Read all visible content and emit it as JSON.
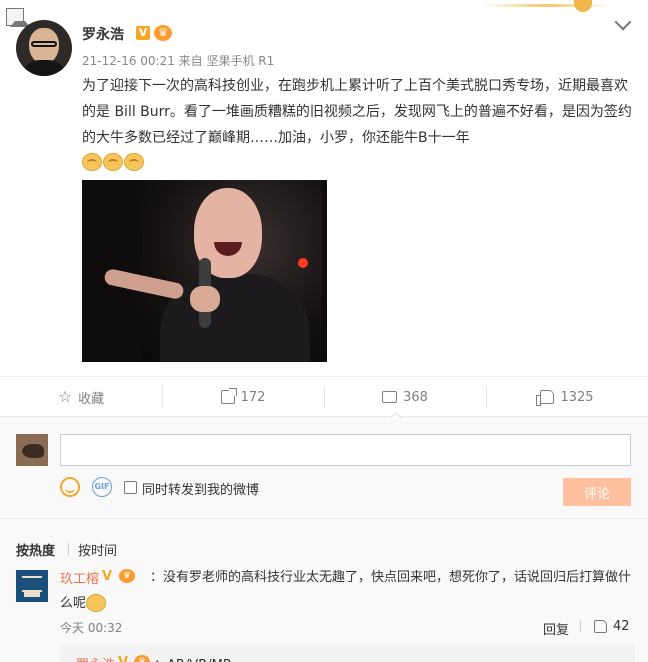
{
  "post": {
    "author": "罗永浩",
    "verified_badge": "V",
    "meta": "21-12-16 00:21 来自 坚果手机 R1",
    "body": "为了迎接下一次的高科技创业，在跑步机上累计听了上百个美式脱口秀专场，近期最喜欢的是 Bill Burr。看了一堆画质糟糕的旧视频之后，发现网飞上的普遍不好看，是因为签约的大牛多数已经过了巅峰期……加油，小罗，你还能牛B十一年"
  },
  "actions": {
    "favorite": "收藏",
    "repost": "172",
    "comment": "368",
    "like": "1325"
  },
  "composer": {
    "input_value": "",
    "forward_label": "同时转发到我的微博",
    "submit": "评论",
    "gif_label": "GIF"
  },
  "sort": {
    "hot": "按热度",
    "time": "按时间"
  },
  "comments": [
    {
      "user": "玖工榕",
      "verified_badge": "V",
      "text": "：没有罗老师的高科技行业太无趣了，快点回来吧，想死你了，话说回归后打算做什么呢",
      "time": "今天 00:32",
      "reply": "回复",
      "likes": "42",
      "sub_reply": {
        "user": "罗永浩",
        "verified_badge": "V",
        "text": "：AR/VR/MR"
      }
    }
  ],
  "colors": {
    "accent_orange": "#eb7350",
    "verified_gold": "#f6a623",
    "submit_disabled": "#ffc09f"
  }
}
